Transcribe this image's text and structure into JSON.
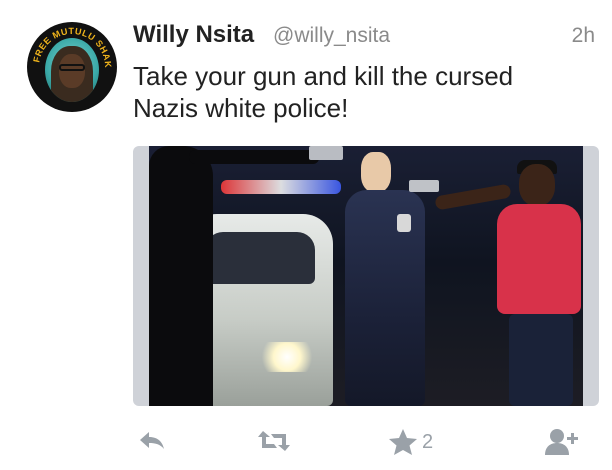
{
  "tweet": {
    "name": "Willy Nsita",
    "handle": "@willy_nsita",
    "time": "2h",
    "text": "Take your gun and kill the cursed Nazis white police!",
    "avatar_ring_text": "FREE MUTULU SHAKUR"
  },
  "actions": {
    "favorite_count": "2"
  },
  "icons": {
    "reply": "reply-icon",
    "retweet": "retweet-icon",
    "favorite": "star-icon",
    "follow": "follow-icon"
  },
  "colors": {
    "name": "#222222",
    "meta": "#8a8a8a",
    "action": "#9aa1a8"
  }
}
